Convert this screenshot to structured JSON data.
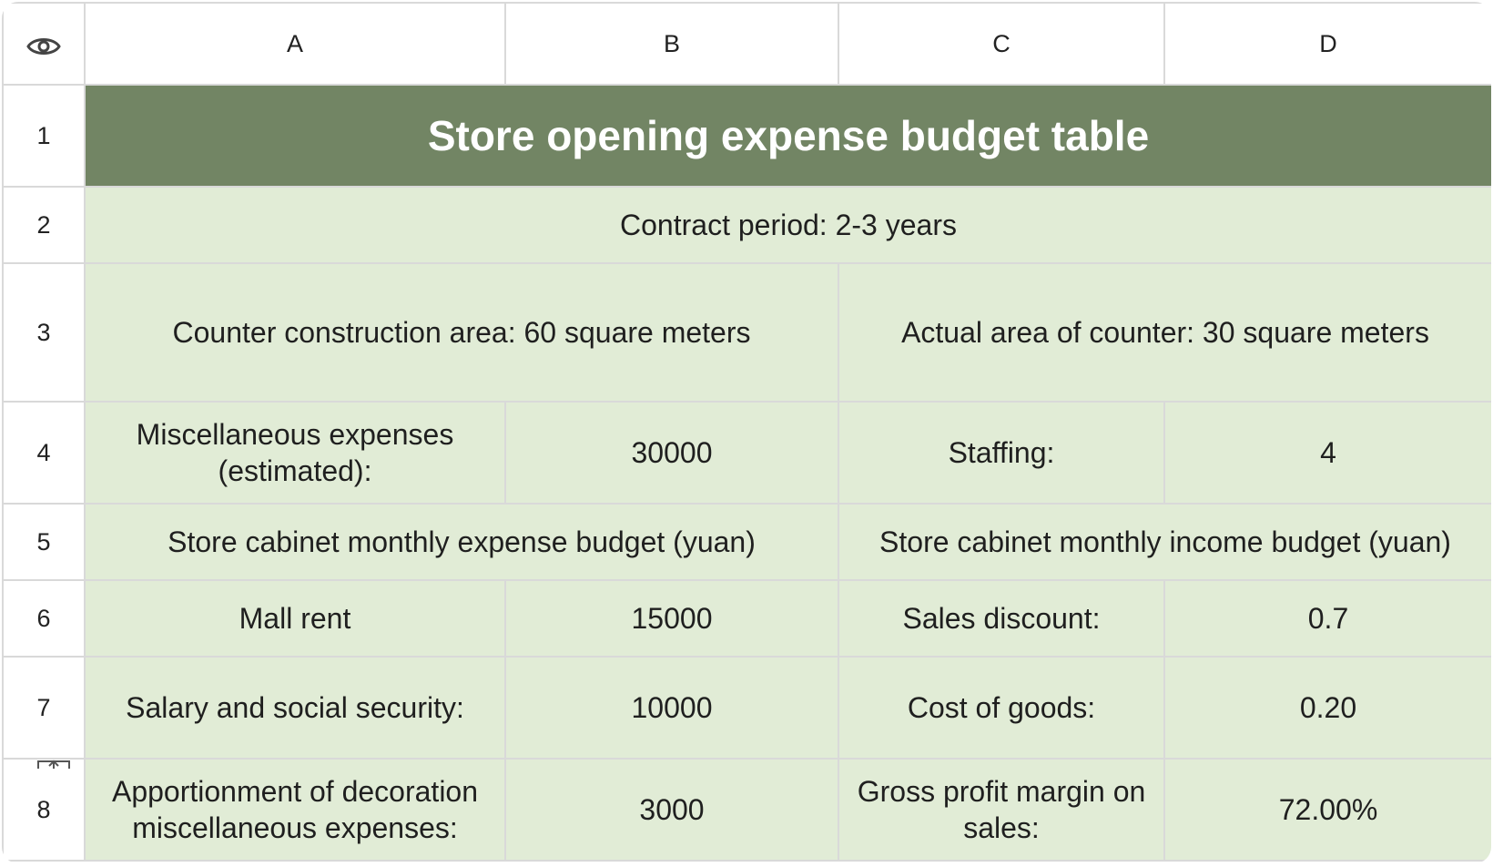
{
  "columns": [
    "A",
    "B",
    "C",
    "D"
  ],
  "rows": [
    "1",
    "2",
    "3",
    "4",
    "5",
    "6",
    "7",
    "8"
  ],
  "icons": {
    "corner": "eye-icon",
    "row_resize": "row-resize-icon"
  },
  "colors": {
    "title_background": "#728564",
    "cell_background": "#e1ecd6",
    "grid_line": "#d9d9d9"
  },
  "cells": {
    "title": "Store opening expense budget table",
    "contract_period": "Contract period: 2-3 years",
    "counter_construction_area": "Counter construction area: 60 square meters",
    "actual_area_of_counter": "Actual area of counter: 30 square meters",
    "misc_expenses_label": "Miscellaneous expenses (estimated):",
    "misc_expenses_value": "30000",
    "staffing_label": "Staffing:",
    "staffing_value": "4",
    "monthly_expense_header": "Store cabinet monthly expense budget (yuan)",
    "monthly_income_header": "Store cabinet monthly income budget (yuan)",
    "mall_rent_label": "Mall rent",
    "mall_rent_value": "15000",
    "sales_discount_label": "Sales discount:",
    "sales_discount_value": "0.7",
    "salary_label": "Salary and social security:",
    "salary_value": "10000",
    "cost_of_goods_label": "Cost of goods:",
    "cost_of_goods_value": "0.20",
    "decoration_label": "Apportionment of decoration miscellaneous expenses:",
    "decoration_value": "3000",
    "gross_margin_label": "Gross profit margin on sales:",
    "gross_margin_value": "72.00%"
  }
}
